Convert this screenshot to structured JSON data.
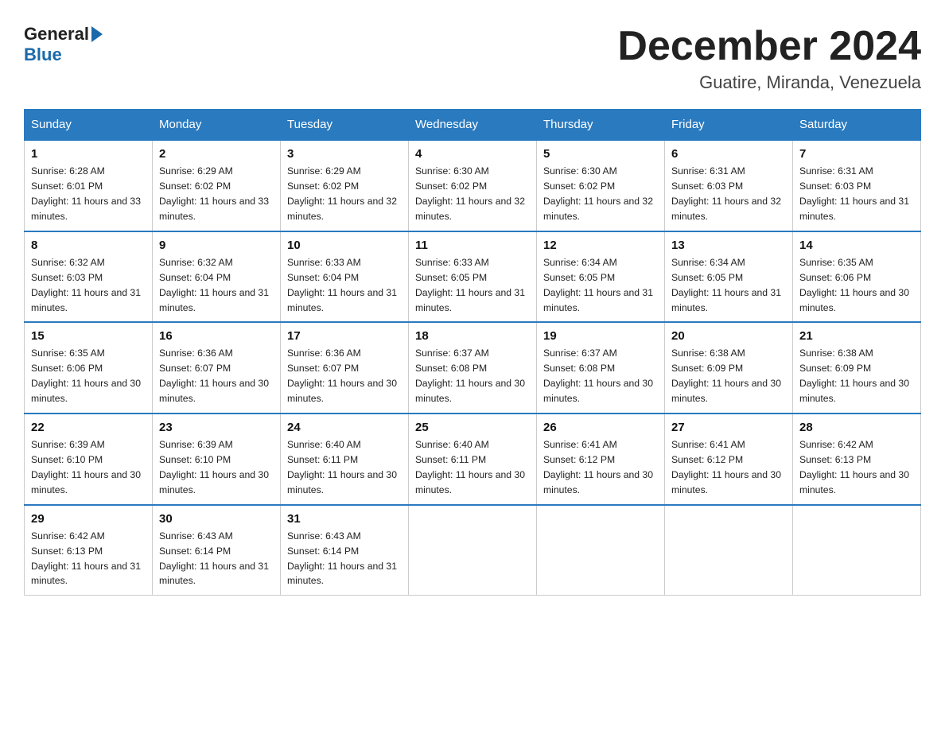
{
  "logo": {
    "general": "General",
    "blue": "Blue"
  },
  "title": "December 2024",
  "location": "Guatire, Miranda, Venezuela",
  "days_of_week": [
    "Sunday",
    "Monday",
    "Tuesday",
    "Wednesday",
    "Thursday",
    "Friday",
    "Saturday"
  ],
  "weeks": [
    [
      {
        "day": "1",
        "sunrise": "6:28 AM",
        "sunset": "6:01 PM",
        "daylight": "11 hours and 33 minutes."
      },
      {
        "day": "2",
        "sunrise": "6:29 AM",
        "sunset": "6:02 PM",
        "daylight": "11 hours and 33 minutes."
      },
      {
        "day": "3",
        "sunrise": "6:29 AM",
        "sunset": "6:02 PM",
        "daylight": "11 hours and 32 minutes."
      },
      {
        "day": "4",
        "sunrise": "6:30 AM",
        "sunset": "6:02 PM",
        "daylight": "11 hours and 32 minutes."
      },
      {
        "day": "5",
        "sunrise": "6:30 AM",
        "sunset": "6:02 PM",
        "daylight": "11 hours and 32 minutes."
      },
      {
        "day": "6",
        "sunrise": "6:31 AM",
        "sunset": "6:03 PM",
        "daylight": "11 hours and 32 minutes."
      },
      {
        "day": "7",
        "sunrise": "6:31 AM",
        "sunset": "6:03 PM",
        "daylight": "11 hours and 31 minutes."
      }
    ],
    [
      {
        "day": "8",
        "sunrise": "6:32 AM",
        "sunset": "6:03 PM",
        "daylight": "11 hours and 31 minutes."
      },
      {
        "day": "9",
        "sunrise": "6:32 AM",
        "sunset": "6:04 PM",
        "daylight": "11 hours and 31 minutes."
      },
      {
        "day": "10",
        "sunrise": "6:33 AM",
        "sunset": "6:04 PM",
        "daylight": "11 hours and 31 minutes."
      },
      {
        "day": "11",
        "sunrise": "6:33 AM",
        "sunset": "6:05 PM",
        "daylight": "11 hours and 31 minutes."
      },
      {
        "day": "12",
        "sunrise": "6:34 AM",
        "sunset": "6:05 PM",
        "daylight": "11 hours and 31 minutes."
      },
      {
        "day": "13",
        "sunrise": "6:34 AM",
        "sunset": "6:05 PM",
        "daylight": "11 hours and 31 minutes."
      },
      {
        "day": "14",
        "sunrise": "6:35 AM",
        "sunset": "6:06 PM",
        "daylight": "11 hours and 30 minutes."
      }
    ],
    [
      {
        "day": "15",
        "sunrise": "6:35 AM",
        "sunset": "6:06 PM",
        "daylight": "11 hours and 30 minutes."
      },
      {
        "day": "16",
        "sunrise": "6:36 AM",
        "sunset": "6:07 PM",
        "daylight": "11 hours and 30 minutes."
      },
      {
        "day": "17",
        "sunrise": "6:36 AM",
        "sunset": "6:07 PM",
        "daylight": "11 hours and 30 minutes."
      },
      {
        "day": "18",
        "sunrise": "6:37 AM",
        "sunset": "6:08 PM",
        "daylight": "11 hours and 30 minutes."
      },
      {
        "day": "19",
        "sunrise": "6:37 AM",
        "sunset": "6:08 PM",
        "daylight": "11 hours and 30 minutes."
      },
      {
        "day": "20",
        "sunrise": "6:38 AM",
        "sunset": "6:09 PM",
        "daylight": "11 hours and 30 minutes."
      },
      {
        "day": "21",
        "sunrise": "6:38 AM",
        "sunset": "6:09 PM",
        "daylight": "11 hours and 30 minutes."
      }
    ],
    [
      {
        "day": "22",
        "sunrise": "6:39 AM",
        "sunset": "6:10 PM",
        "daylight": "11 hours and 30 minutes."
      },
      {
        "day": "23",
        "sunrise": "6:39 AM",
        "sunset": "6:10 PM",
        "daylight": "11 hours and 30 minutes."
      },
      {
        "day": "24",
        "sunrise": "6:40 AM",
        "sunset": "6:11 PM",
        "daylight": "11 hours and 30 minutes."
      },
      {
        "day": "25",
        "sunrise": "6:40 AM",
        "sunset": "6:11 PM",
        "daylight": "11 hours and 30 minutes."
      },
      {
        "day": "26",
        "sunrise": "6:41 AM",
        "sunset": "6:12 PM",
        "daylight": "11 hours and 30 minutes."
      },
      {
        "day": "27",
        "sunrise": "6:41 AM",
        "sunset": "6:12 PM",
        "daylight": "11 hours and 30 minutes."
      },
      {
        "day": "28",
        "sunrise": "6:42 AM",
        "sunset": "6:13 PM",
        "daylight": "11 hours and 30 minutes."
      }
    ],
    [
      {
        "day": "29",
        "sunrise": "6:42 AM",
        "sunset": "6:13 PM",
        "daylight": "11 hours and 31 minutes."
      },
      {
        "day": "30",
        "sunrise": "6:43 AM",
        "sunset": "6:14 PM",
        "daylight": "11 hours and 31 minutes."
      },
      {
        "day": "31",
        "sunrise": "6:43 AM",
        "sunset": "6:14 PM",
        "daylight": "11 hours and 31 minutes."
      },
      null,
      null,
      null,
      null
    ]
  ]
}
